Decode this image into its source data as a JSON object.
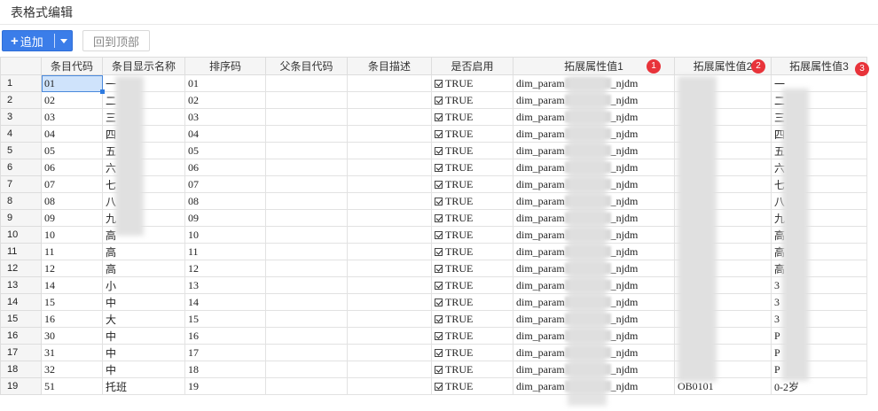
{
  "page": {
    "title": "表格式编辑"
  },
  "toolbar": {
    "add_label": "追加",
    "top_label": "回到顶部"
  },
  "table": {
    "headers": [
      "条目代码",
      "条目显示名称",
      "排序码",
      "父条目代码",
      "条目描述",
      "是否启用",
      "拓展属性值1",
      "拓展属性值2",
      "拓展属性值3"
    ],
    "badges": [
      "1",
      "2",
      "3"
    ],
    "rows": [
      {
        "n": "1",
        "code": "01",
        "name": "一",
        "sort": "01",
        "enabled": "TRUE",
        "ext1a": "dim_param",
        "ext1b": "_njdm",
        "ext2": "",
        "ext3": "一"
      },
      {
        "n": "2",
        "code": "02",
        "name": "二",
        "sort": "02",
        "enabled": "TRUE",
        "ext1a": "dim_param",
        "ext1b": "_njdm",
        "ext2": "",
        "ext3": "二"
      },
      {
        "n": "3",
        "code": "03",
        "name": "三",
        "sort": "03",
        "enabled": "TRUE",
        "ext1a": "dim_param",
        "ext1b": "_njdm",
        "ext2": "",
        "ext3": "三"
      },
      {
        "n": "4",
        "code": "04",
        "name": "四",
        "sort": "04",
        "enabled": "TRUE",
        "ext1a": "dim_param",
        "ext1b": "_njdm",
        "ext2": "",
        "ext3": "四"
      },
      {
        "n": "5",
        "code": "05",
        "name": "五",
        "sort": "05",
        "enabled": "TRUE",
        "ext1a": "dim_param",
        "ext1b": "_njdm",
        "ext2": "",
        "ext3": "五"
      },
      {
        "n": "6",
        "code": "06",
        "name": "六",
        "sort": "06",
        "enabled": "TRUE",
        "ext1a": "dim_param",
        "ext1b": "_njdm",
        "ext2": "",
        "ext3": "六"
      },
      {
        "n": "7",
        "code": "07",
        "name": "七",
        "sort": "07",
        "enabled": "TRUE",
        "ext1a": "dim_param",
        "ext1b": "_njdm",
        "ext2": "",
        "ext3": "七"
      },
      {
        "n": "8",
        "code": "08",
        "name": "八",
        "sort": "08",
        "enabled": "TRUE",
        "ext1a": "dim_param",
        "ext1b": "_njdm",
        "ext2": "",
        "ext3": "八"
      },
      {
        "n": "9",
        "code": "09",
        "name": "九",
        "sort": "09",
        "enabled": "TRUE",
        "ext1a": "dim_param",
        "ext1b": "_njdm",
        "ext2": "",
        "ext3": "九"
      },
      {
        "n": "10",
        "code": "10",
        "name": "高",
        "sort": "10",
        "enabled": "TRUE",
        "ext1a": "dim_param",
        "ext1b": "_njdm",
        "ext2": "",
        "ext3": "高"
      },
      {
        "n": "11",
        "code": "11",
        "name": "高",
        "sort": "11",
        "enabled": "TRUE",
        "ext1a": "dim_param",
        "ext1b": "_njdm",
        "ext2": "",
        "ext3": "高"
      },
      {
        "n": "12",
        "code": "12",
        "name": "高",
        "sort": "12",
        "enabled": "TRUE",
        "ext1a": "dim_param",
        "ext1b": "_njdm",
        "ext2": "",
        "ext3": "高"
      },
      {
        "n": "13",
        "code": "14",
        "name": "小",
        "sort": "13",
        "enabled": "TRUE",
        "ext1a": "dim_param",
        "ext1b": "_njdm",
        "ext2": "",
        "ext3": "3"
      },
      {
        "n": "14",
        "code": "15",
        "name": "中",
        "sort": "14",
        "enabled": "TRUE",
        "ext1a": "dim_param",
        "ext1b": "_njdm",
        "ext2": "",
        "ext3": "3"
      },
      {
        "n": "15",
        "code": "16",
        "name": "大",
        "sort": "15",
        "enabled": "TRUE",
        "ext1a": "dim_param",
        "ext1b": "_njdm",
        "ext2": "",
        "ext3": "3"
      },
      {
        "n": "16",
        "code": "30",
        "name": "中",
        "sort": "16",
        "enabled": "TRUE",
        "ext1a": "dim_param",
        "ext1b": "_njdm",
        "ext2": "",
        "ext3": "P"
      },
      {
        "n": "17",
        "code": "31",
        "name": "中",
        "sort": "17",
        "enabled": "TRUE",
        "ext1a": "dim_param",
        "ext1b": "_njdm",
        "ext2": "",
        "ext3": "P"
      },
      {
        "n": "18",
        "code": "32",
        "name": "中",
        "sort": "18",
        "enabled": "TRUE",
        "ext1a": "dim_param",
        "ext1b": "_njdm",
        "ext2": "",
        "ext3": "P"
      },
      {
        "n": "19",
        "code": "51",
        "name": "托班",
        "sort": "19",
        "enabled": "TRUE",
        "ext1a": "dim_param",
        "ext1b": "_njdm",
        "ext2": "OB0101",
        "ext3": "0-2岁"
      }
    ]
  },
  "colors": {
    "accent": "#3b7de9",
    "badge": "#e8333a",
    "selection": "#cfe3fb"
  }
}
